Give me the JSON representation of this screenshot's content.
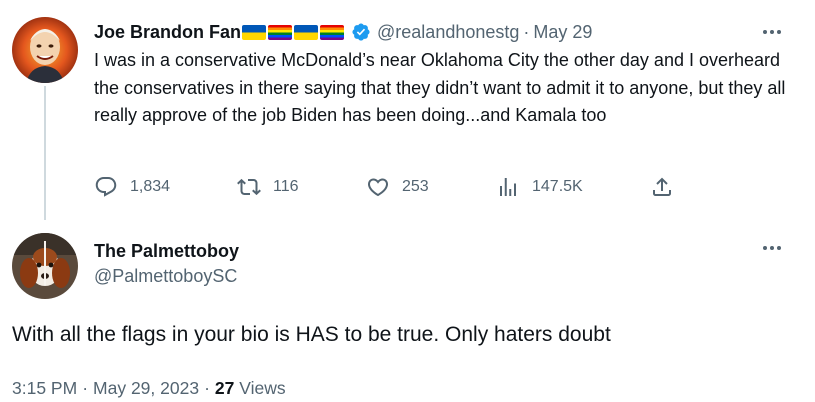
{
  "thread": {
    "parent": {
      "display_name": "Joe Brandon Fan",
      "flags": [
        "ukraine-flag",
        "rainbow-flag",
        "ukraine-flag",
        "rainbow-flag"
      ],
      "verified_icon": "verified-badge-icon",
      "handle": "@realandhonestg",
      "separator": "·",
      "date": "May 29",
      "text": "I was in a conservative McDonald’s near Oklahoma City the other day and I overheard the conservatives in there saying that they didn’t want to admit it to anyone, but they all really approve of the job Biden has been doing...and Kamala too",
      "actions": {
        "replies": "1,834",
        "retweets": "116",
        "likes": "253",
        "views": "147.5K"
      }
    },
    "reply": {
      "display_name": "The Palmettoboy",
      "handle": "@PalmettoboySC",
      "text": "With all the flags in your bio is HAS to be true. Only haters doubt",
      "time": "3:15 PM",
      "separator": "·",
      "date": "May 29, 2023",
      "views_count": "27",
      "views_label": "Views"
    }
  },
  "colors": {
    "text_primary": "#0f1419",
    "text_secondary": "#536471",
    "verified_blue": "#1d9bf0",
    "thread_line": "#cfd9de",
    "ukraine_blue": "#0057b7",
    "ukraine_yellow": "#ffd700"
  }
}
